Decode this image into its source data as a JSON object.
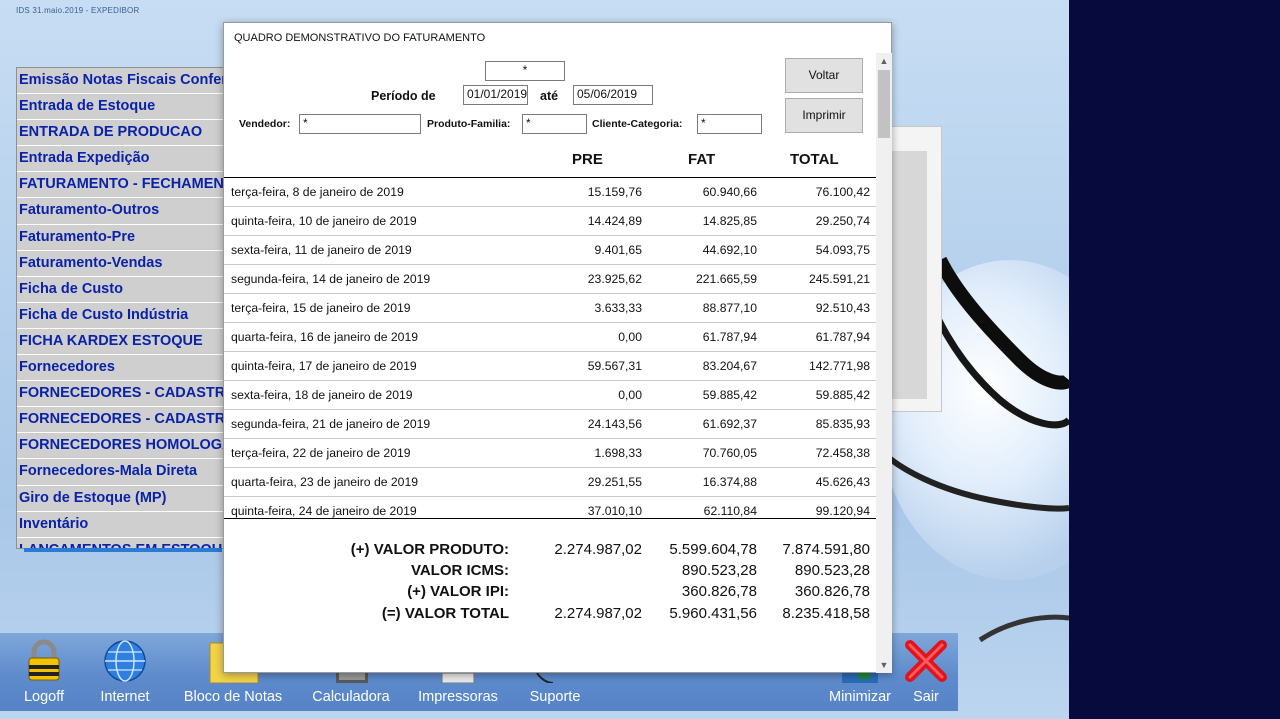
{
  "header_text": "IDS 31.maio.2019   -   EXPEDIBOR",
  "menu_items": [
    "Emissão Notas Fiscais Conferência",
    "Entrada de Estoque",
    "ENTRADA DE PRODUCAO",
    "Entrada Expedição",
    "FATURAMENTO - FECHAMENTO",
    "Faturamento-Outros",
    "Faturamento-Pre",
    "Faturamento-Vendas",
    "Ficha de Custo",
    "Ficha de Custo Indústria",
    "FICHA KARDEX ESTOQUE",
    "Fornecedores",
    "FORNECEDORES - CADASTRO",
    "FORNECEDORES - CADASTRO",
    "FORNECEDORES HOMOLOGADOS",
    "Fornecedores-Mala Direta",
    "Giro de Estoque (MP)",
    "Inventário",
    "LANCAMENTOS EM ESTOQUE"
  ],
  "report": {
    "title": "QUADRO DEMONSTRATIVO DO FATURAMENTO",
    "top_filter": "*",
    "periodo_label": "Período de",
    "date_from": "01/01/2019",
    "ate_label": "até",
    "date_to": "05/06/2019",
    "vendedor_label": "Vendedor:",
    "vendedor_value": "*",
    "produto_label": "Produto-Familia:",
    "produto_value": "*",
    "cliente_label": "Cliente-Categoria:",
    "cliente_value": "*",
    "voltar_label": "Voltar",
    "imprimir_label": "Imprimir",
    "columns": {
      "pre": "PRE",
      "fat": "FAT",
      "total": "TOTAL"
    },
    "rows": [
      {
        "date": "terça-feira, 8 de janeiro de 2019",
        "pre": "15.159,76",
        "fat": "60.940,66",
        "total": "76.100,42"
      },
      {
        "date": "quinta-feira, 10 de janeiro de 2019",
        "pre": "14.424,89",
        "fat": "14.825,85",
        "total": "29.250,74"
      },
      {
        "date": "sexta-feira, 11 de janeiro de 2019",
        "pre": "9.401,65",
        "fat": "44.692,10",
        "total": "54.093,75"
      },
      {
        "date": "segunda-feira, 14 de janeiro de 2019",
        "pre": "23.925,62",
        "fat": "221.665,59",
        "total": "245.591,21"
      },
      {
        "date": "terça-feira, 15 de janeiro de 2019",
        "pre": "3.633,33",
        "fat": "88.877,10",
        "total": "92.510,43"
      },
      {
        "date": "quarta-feira, 16 de janeiro de 2019",
        "pre": "0,00",
        "fat": "61.787,94",
        "total": "61.787,94"
      },
      {
        "date": "quinta-feira, 17 de janeiro de 2019",
        "pre": "59.567,31",
        "fat": "83.204,67",
        "total": "142.771,98"
      },
      {
        "date": "sexta-feira, 18 de janeiro de 2019",
        "pre": "0,00",
        "fat": "59.885,42",
        "total": "59.885,42"
      },
      {
        "date": "segunda-feira, 21 de janeiro de 2019",
        "pre": "24.143,56",
        "fat": "61.692,37",
        "total": "85.835,93"
      },
      {
        "date": "terça-feira, 22 de janeiro de 2019",
        "pre": "1.698,33",
        "fat": "70.760,05",
        "total": "72.458,38"
      },
      {
        "date": "quarta-feira, 23 de janeiro de 2019",
        "pre": "29.251,55",
        "fat": "16.374,88",
        "total": "45.626,43"
      },
      {
        "date": "quinta-feira, 24 de janeiro de 2019",
        "pre": "37.010,10",
        "fat": "62.110,84",
        "total": "99.120,94"
      }
    ],
    "summary": [
      {
        "label": "(+) VALOR PRODUTO:",
        "pre": "2.274.987,02",
        "fat": "5.599.604,78",
        "total": "7.874.591,80"
      },
      {
        "label": "VALOR ICMS:",
        "pre": "",
        "fat": "890.523,28",
        "total": "890.523,28"
      },
      {
        "label": "(+) VALOR IPI:",
        "pre": "",
        "fat": "360.826,78",
        "total": "360.826,78"
      },
      {
        "label": "(=) VALOR TOTAL",
        "pre": "2.274.987,02",
        "fat": "5.960.431,56",
        "total": "8.235.418,58"
      }
    ]
  },
  "taskbar": {
    "logoff": "Logoff",
    "internet": "Internet",
    "bloco": "Bloco de Notas",
    "calculadora": "Calculadora",
    "impressoras": "Impressoras",
    "suporte": "Suporte",
    "minimizar": "Minimizar",
    "sair": "Sair"
  },
  "icons": {
    "logoff": "padlock-icon",
    "internet": "globe-icon",
    "bloco": "notepad-icon",
    "calculadora": "calculator-icon",
    "impressoras": "printer-icon",
    "suporte": "support-icon",
    "minimizar": "minimize-icon",
    "sair": "red-x-icon"
  },
  "colors": {
    "menu_text": "#0a22a8",
    "menu_bg": "#cfcfcf",
    "taskbar": "#5e8bcc",
    "dark_strip": "#060a3c",
    "sair_red": "#e0141c"
  }
}
